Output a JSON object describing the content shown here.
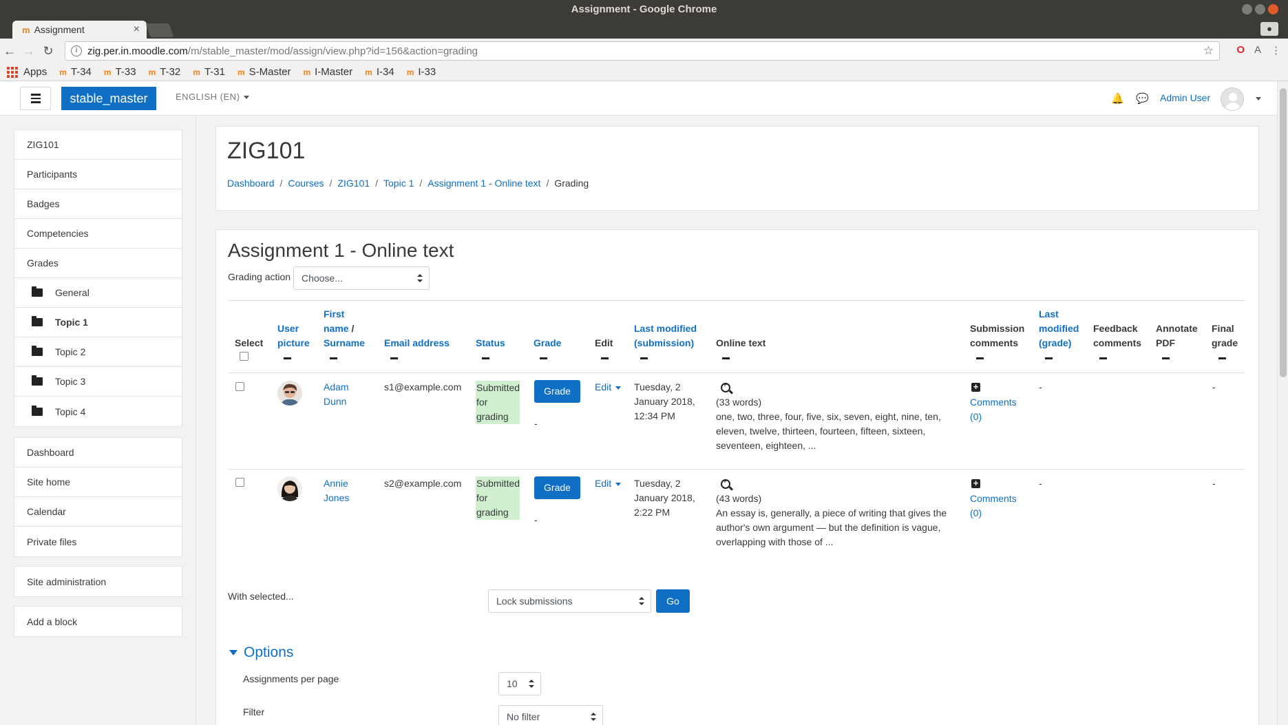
{
  "window": {
    "title": "Assignment - Google Chrome"
  },
  "browser": {
    "tab_title": "Assignment",
    "url_host": "zig.per.in.moodle.com",
    "url_path": "/m/stable_master/mod/assign/view.php?id=156&action=grading",
    "bookmarks": [
      "Apps",
      "T-34",
      "T-33",
      "T-32",
      "T-31",
      "S-Master",
      "I-Master",
      "I-34",
      "I-33"
    ]
  },
  "navbar": {
    "site_name": "stable_master",
    "language": "ENGLISH (EN)",
    "user_name": "Admin User"
  },
  "drawer": {
    "course_items": [
      "ZIG101",
      "Participants",
      "Badges",
      "Competencies",
      "Grades"
    ],
    "section_items": [
      "General",
      "Topic 1",
      "Topic 2",
      "Topic 3",
      "Topic 4"
    ],
    "site_items": [
      "Dashboard",
      "Site home",
      "Calendar",
      "Private files"
    ],
    "admin": "Site administration",
    "add_block": "Add a block"
  },
  "page": {
    "course_title": "ZIG101",
    "breadcrumb": [
      "Dashboard",
      "Courses",
      "ZIG101",
      "Topic 1",
      "Assignment 1 - Online text",
      "Grading"
    ],
    "heading": "Assignment 1 - Online text",
    "grading_action_label": "Grading action",
    "grading_action_value": "Choose..."
  },
  "table": {
    "headers": {
      "select": "Select",
      "user_picture_1": "User",
      "user_picture_2": "picture",
      "name_1": "First",
      "name_2": "name",
      "name_slash": " /",
      "name_3": "Surname",
      "email": "Email address",
      "status": "Status",
      "grade": "Grade",
      "edit": "Edit",
      "last_mod_1": "Last modified",
      "last_mod_2": "(submission)",
      "online_text": "Online text",
      "sub_comments_1": "Submission",
      "sub_comments_2": "comments",
      "last_grade_1": "Last",
      "last_grade_2": "modified",
      "last_grade_3": "(grade)",
      "feedback_1": "Feedback",
      "feedback_2": "comments",
      "annotate_1": "Annotate",
      "annotate_2": "PDF",
      "final_1": "Final",
      "final_2": "grade"
    },
    "rows": [
      {
        "first_name": "Adam",
        "surname": "Dunn",
        "email": "s1@example.com",
        "status_1": "Submitted",
        "status_2": "for",
        "status_3": "grading",
        "grade_button": "Grade",
        "grade_value": "-",
        "edit": "Edit",
        "modified_1": "Tuesday, 2",
        "modified_2": "January 2018,",
        "modified_3": "12:34 PM",
        "words": "(33 words)",
        "text_1": "one, two, three, four, five, six, seven, eight, nine, ten,",
        "text_2": "eleven, twelve, thirteen, fourteen, fifteen, sixteen,",
        "text_3": "seventeen, eighteen, ...",
        "comments_1": "Comments",
        "comments_2": "(0)",
        "last_grade": "-",
        "final_grade": "-"
      },
      {
        "first_name": "Annie",
        "surname": "Jones",
        "email": "s2@example.com",
        "status_1": "Submitted",
        "status_2": "for",
        "status_3": "grading",
        "grade_button": "Grade",
        "grade_value": "-",
        "edit": "Edit",
        "modified_1": "Tuesday, 2",
        "modified_2": "January 2018,",
        "modified_3": "2:22 PM",
        "words": "(43 words)",
        "text_1": "An essay is, generally, a piece of writing that gives the",
        "text_2": "author's own argument — but the definition is vague,",
        "text_3": "overlapping with those of ...",
        "comments_1": "Comments",
        "comments_2": "(0)",
        "last_grade": "-",
        "final_grade": "-"
      }
    ]
  },
  "bulk": {
    "label": "With selected...",
    "action": "Lock submissions",
    "go": "Go"
  },
  "options": {
    "heading": "Options",
    "per_page_label": "Assignments per page",
    "per_page_value": "10",
    "filter_label": "Filter",
    "filter_value": "No filter"
  },
  "colors": {
    "accent": "#0f6fc5",
    "submitted_bg": "#cfefcf"
  }
}
